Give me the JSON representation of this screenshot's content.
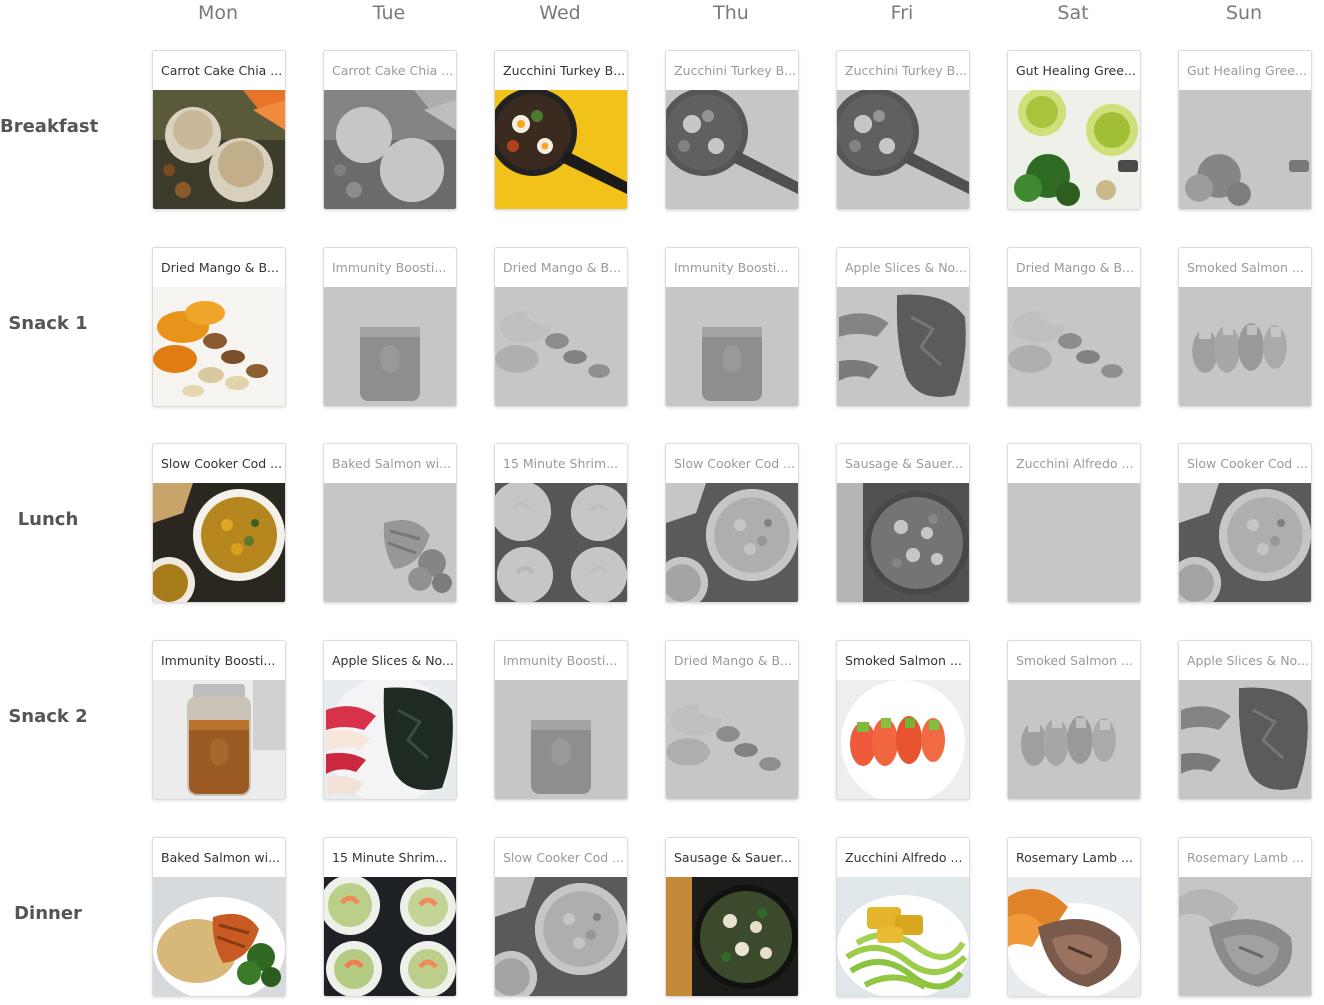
{
  "days": [
    "Mon",
    "Tue",
    "Wed",
    "Thu",
    "Fri",
    "Sat",
    "Sun"
  ],
  "meals": [
    "Breakfast",
    "Snack 1",
    "Lunch",
    "Snack 2",
    "Dinner"
  ],
  "grid": [
    [
      {
        "title": "Carrot Cake Chia ...",
        "icon": "chia-pudding-photo",
        "active": true
      },
      {
        "title": "Carrot Cake Chia ...",
        "icon": "chia-pudding-photo",
        "active": false
      },
      {
        "title": "Zucchini Turkey B...",
        "icon": "skillet-photo",
        "active": true
      },
      {
        "title": "Zucchini Turkey B...",
        "icon": "skillet-photo",
        "active": false
      },
      {
        "title": "Zucchini Turkey B...",
        "icon": "skillet-photo",
        "active": false
      },
      {
        "title": "Gut Healing Gree...",
        "icon": "green-smoothie-photo",
        "active": true
      },
      {
        "title": "Gut Healing Gree...",
        "icon": "green-smoothie-photo",
        "active": false
      }
    ],
    [
      {
        "title": "Dried Mango & B...",
        "icon": "mango-nuts-photo",
        "active": true
      },
      {
        "title": "Immunity Boosti...",
        "icon": "broth-jar-photo",
        "active": false
      },
      {
        "title": "Dried Mango & B...",
        "icon": "mango-nuts-photo",
        "active": false
      },
      {
        "title": "Immunity Boosti...",
        "icon": "broth-jar-photo",
        "active": false
      },
      {
        "title": "Apple Slices & No...",
        "icon": "apple-nori-photo",
        "active": false
      },
      {
        "title": "Dried Mango & B...",
        "icon": "mango-nuts-photo",
        "active": false
      },
      {
        "title": "Smoked Salmon ...",
        "icon": "salmon-rolls-photo",
        "active": false
      }
    ],
    [
      {
        "title": "Slow Cooker Cod ...",
        "icon": "cod-stew-photo",
        "active": true
      },
      {
        "title": "Baked Salmon wi...",
        "icon": "baked-salmon-photo",
        "active": false
      },
      {
        "title": "15 Minute Shrim...",
        "icon": "shrimp-bowls-photo",
        "active": false
      },
      {
        "title": "Slow Cooker Cod ...",
        "icon": "cod-stew-photo",
        "active": false
      },
      {
        "title": "Sausage & Sauer...",
        "icon": "sausage-skillet-photo",
        "active": false
      },
      {
        "title": "Zucchini Alfredo ...",
        "icon": "zucchini-noodles-photo",
        "active": false
      },
      {
        "title": "Slow Cooker Cod ...",
        "icon": "cod-stew-photo",
        "active": false
      }
    ],
    [
      {
        "title": "Immunity Boosti...",
        "icon": "broth-jar-photo",
        "active": true
      },
      {
        "title": "Apple Slices & No...",
        "icon": "apple-nori-photo",
        "active": true
      },
      {
        "title": "Immunity Boosti...",
        "icon": "broth-jar-photo",
        "active": false
      },
      {
        "title": "Dried Mango & B...",
        "icon": "mango-nuts-photo",
        "active": false
      },
      {
        "title": "Smoked Salmon ...",
        "icon": "salmon-rolls-photo",
        "active": true
      },
      {
        "title": "Smoked Salmon ...",
        "icon": "salmon-rolls-photo",
        "active": false
      },
      {
        "title": "Apple Slices & No...",
        "icon": "apple-nori-photo",
        "active": false
      }
    ],
    [
      {
        "title": "Baked Salmon wi...",
        "icon": "baked-salmon-photo",
        "active": true
      },
      {
        "title": "15 Minute Shrim...",
        "icon": "shrimp-bowls-photo",
        "active": true
      },
      {
        "title": "Slow Cooker Cod ...",
        "icon": "cod-stew-photo",
        "active": false
      },
      {
        "title": "Sausage & Sauer...",
        "icon": "sausage-skillet-photo",
        "active": true
      },
      {
        "title": "Zucchini Alfredo ...",
        "icon": "zucchini-noodles-photo",
        "active": true
      },
      {
        "title": "Rosemary Lamb ...",
        "icon": "lamb-chop-photo",
        "active": true
      },
      {
        "title": "Rosemary Lamb ...",
        "icon": "lamb-chop-photo",
        "active": false
      }
    ]
  ]
}
